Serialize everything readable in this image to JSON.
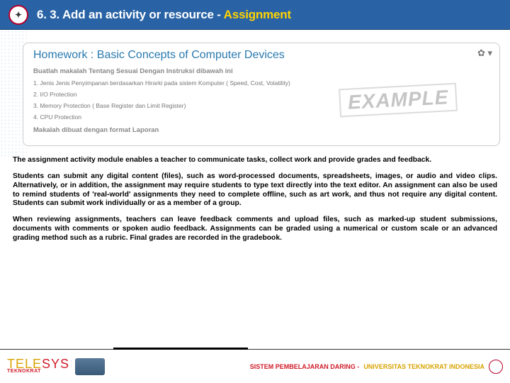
{
  "header": {
    "title_prefix": "6. 3. Add an activity or resource - ",
    "title_highlight": "Assignment"
  },
  "screenshot": {
    "hw_title": "Homework : Basic Concepts of Computer Devices",
    "instruction": "Buatlah makalah Tentang Sesuai Dengan Instruksi dibawah ini",
    "items": [
      "1. Jenis Jenis Penyimpanan berdasarkan Hirarki pada sistem Komputer ( Speed, Cost, Volatility)",
      "2. I/O Protection",
      "3. Memory Protection ( Base Register dan Limit Register)",
      "4. CPU Protection"
    ],
    "closing": "Makalah dibuat dengan format Laporan",
    "stamp": "EXAMPLE",
    "gear": "✿ ▾"
  },
  "body": {
    "p1": "The assignment activity module enables a teacher to communicate tasks, collect work and provide grades and feedback.",
    "p2": "Students can submit any digital content (files), such as word-processed documents, spreadsheets, images, or audio and video clips. Alternatively, or in addition, the assignment may require students to type text directly into the text editor. An assignment can also be used to remind students of 'real-world' assignments they need to complete offline, such as art work, and thus not require any digital content. Students can submit work individually or as a member of a group.",
    "p3": "When reviewing assignments, teachers can leave feedback comments and upload files, such as marked-up student submissions, documents with comments or spoken audio feedback. Assignments can be graded using a numerical or custom scale or an advanced grading method such as a rubric. Final grades are recorded in the gradebook."
  },
  "footer": {
    "logo_part1": "TELE",
    "logo_part2": "SYS",
    "logo_sub": "TEKNOKRAT",
    "tagline1": "SISTEM PEMBELAJARAN DARING - ",
    "tagline2": "UNIVERSITAS TEKNOKRAT INDONESIA"
  }
}
